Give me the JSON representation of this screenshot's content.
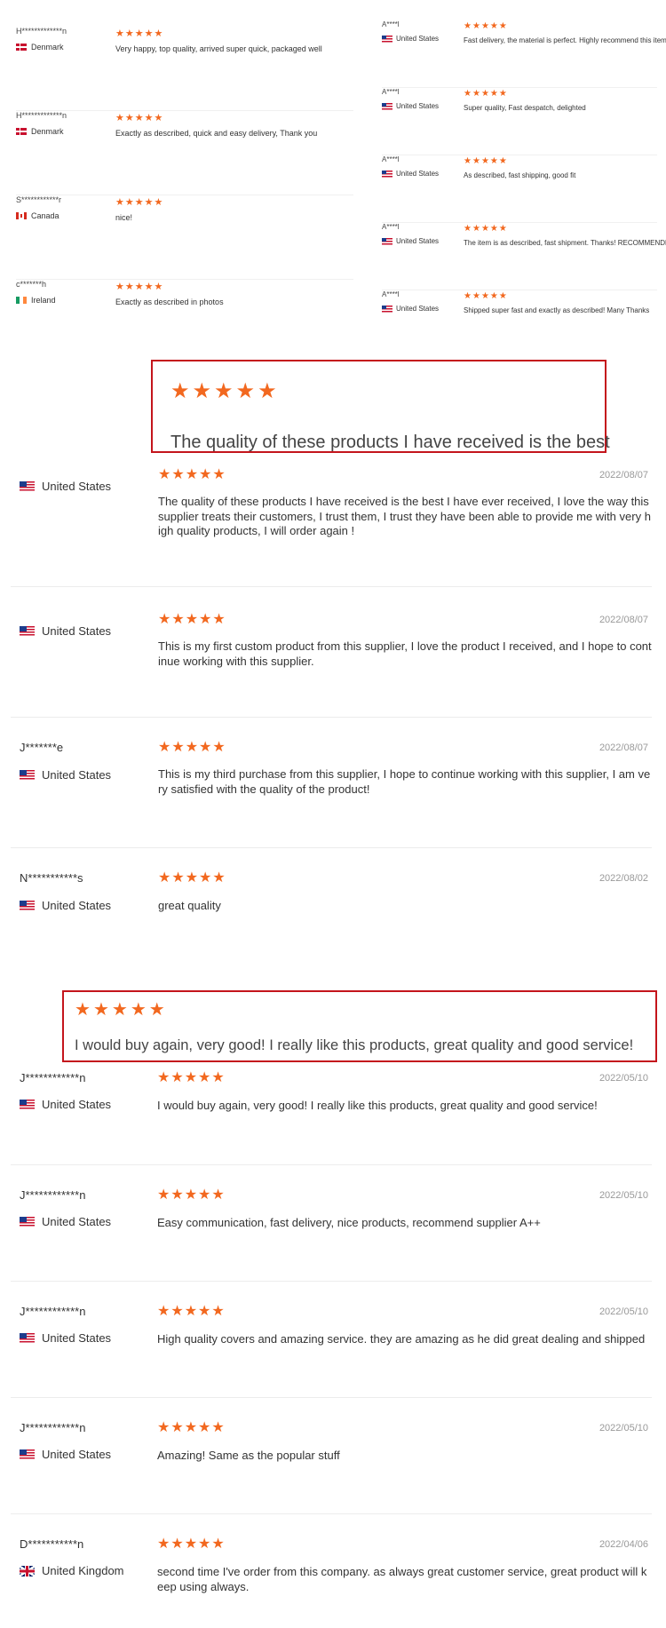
{
  "top_left_reviews": [
    {
      "name": "H*************n",
      "country": "Denmark",
      "flag": "dk",
      "rating": 5,
      "text": "Very happy, top quality, arrived super quick, packaged well"
    },
    {
      "name": "H*************n",
      "country": "Denmark",
      "flag": "dk",
      "rating": 5,
      "text": "Exactly as described, quick and easy delivery, Thank you"
    },
    {
      "name": "S************r",
      "country": "Canada",
      "flag": "ca",
      "rating": 5,
      "text": "nice!"
    },
    {
      "name": "c*******h",
      "country": "Ireland",
      "flag": "ie",
      "rating": 5,
      "text": "Exactly as described in photos"
    }
  ],
  "top_right_reviews": [
    {
      "name": "A****l",
      "country": "United States",
      "flag": "us",
      "rating": 5,
      "text": "Fast delivery, the material is perfect. Highly recommend this item"
    },
    {
      "name": "A****l",
      "country": "United States",
      "flag": "us",
      "rating": 5,
      "text": "Super quality, Fast despatch, delighted"
    },
    {
      "name": "A****l",
      "country": "United States",
      "flag": "us",
      "rating": 5,
      "text": "As described, fast shipping, good fit"
    },
    {
      "name": "A****l",
      "country": "United States",
      "flag": "us",
      "rating": 5,
      "text": "The item is as described, fast shipment. Thanks! RECOMMENDED!"
    },
    {
      "name": "A****l",
      "country": "United States",
      "flag": "us",
      "rating": 5,
      "text": "Shipped super fast and exactly as described! Many Thanks"
    }
  ],
  "highlight_1": {
    "rating": 5,
    "text": "The quality of these products I have received is the best"
  },
  "highlight_2": {
    "rating": 5,
    "text": "I would buy again, very good! I really like this products, great quality and good service!"
  },
  "reviews_group_1": [
    {
      "name": "",
      "country": "United States",
      "flag": "us",
      "rating": 5,
      "date": "2022/08/07",
      "text": "The quality of these products I have received is the best I have ever received, I love the way this supplier treats their customers, I trust them, I trust they have been able to provide me with very high quality products, I will order again !"
    },
    {
      "name": "",
      "country": "United States",
      "flag": "us",
      "rating": 5,
      "date": "2022/08/07",
      "text": "This is my first custom product from this supplier, I love the product I received, and I hope to continue working with this supplier."
    },
    {
      "name": "J*******e",
      "country": "United States",
      "flag": "us",
      "rating": 5,
      "date": "2022/08/07",
      "text": "This is my third purchase from this supplier, I hope to continue working with this supplier, I am very satisfied with the quality of the product!"
    },
    {
      "name": "N***********s",
      "country": "United States",
      "flag": "us",
      "rating": 5,
      "date": "2022/08/02",
      "text": "great quality"
    }
  ],
  "reviews_group_2": [
    {
      "name": "J************n",
      "country": "United States",
      "flag": "us",
      "rating": 5,
      "date": "2022/05/10",
      "text": "I would buy again, very good! I really like this products, great quality and good service!"
    },
    {
      "name": "J************n",
      "country": "United States",
      "flag": "us",
      "rating": 5,
      "date": "2022/05/10",
      "text": "Easy communication, fast delivery, nice products, recommend supplier A++"
    },
    {
      "name": "J************n",
      "country": "United States",
      "flag": "us",
      "rating": 5,
      "date": "2022/05/10",
      "text": "High quality covers and amazing service. they are amazing as he did great dealing and shipped"
    },
    {
      "name": "J************n",
      "country": "United States",
      "flag": "us",
      "rating": 5,
      "date": "2022/05/10",
      "text": "Amazing! Same as the popular stuff"
    },
    {
      "name": "D***********n",
      "country": "United Kingdom",
      "flag": "gb",
      "rating": 5,
      "date": "2022/04/06",
      "text": "second time I've order from this company. as always great customer service, great product will keep using always."
    }
  ],
  "star_icon": "star-icon",
  "colors": {
    "star": "#f2681f",
    "highlight_border": "#c4151c",
    "date": "#999999"
  }
}
